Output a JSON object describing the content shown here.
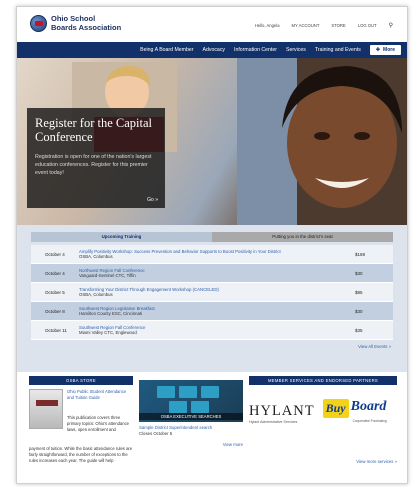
{
  "header": {
    "org_name_line1": "Ohio School",
    "org_name_line2": "Boards Association",
    "greeting": "Hello, Angela",
    "my_account": "MY ACCOUNT",
    "store": "STORE",
    "log_out": "LOG OUT"
  },
  "nav": {
    "items": [
      "Being A Board Member",
      "Advocacy",
      "Information Center",
      "Services",
      "Training and Events"
    ],
    "more_label": "More"
  },
  "hero": {
    "title": "Register for the Capital Conference",
    "text": "Registration is open for one of the nation's largest education conferences. Register for this premier event today!",
    "go_label": "Go »"
  },
  "tabs": {
    "upcoming": "Upcoming Training",
    "district": "Putting you in the district's seat"
  },
  "events": [
    {
      "date": "October 4",
      "title": "Amplify Positivity Workshop: Success Prevention and Behavior Supports to Boost Positivity in Your District",
      "location": "OSBA, Columbus",
      "price": "$169"
    },
    {
      "date": "October 4",
      "title": "Northwest Region Fall Conference",
      "location": "Vanguard-Sentinel CTC, Tiffin",
      "price": "$30"
    },
    {
      "date": "October 5",
      "title": "Transforming Your District Through Engagement Workshop (CANCELED)",
      "location": "OSBA, Columbus",
      "price": "$85"
    },
    {
      "date": "October 8",
      "title": "Southwest Region Legislative Breakfast",
      "location": "Hamilton County ESC, Cincinnati",
      "price": "$30"
    },
    {
      "date": "October 11",
      "title": "Southwest Region Fall Conference",
      "location": "Miami Valley CTC, Englewood",
      "price": "$35"
    }
  ],
  "events_view_all": "View All Events »",
  "store": {
    "heading": "OSBA STORE",
    "title": "Ohio Public Student Attendance and Tuition Guide",
    "text": "This publication covers three primary topics: Ohio's attendance laws, open enrollment and",
    "text2": "payment of tuition. While the basic attendance rules are fairly straightforward, the number of exceptions to the rules increases each year. The guide will help"
  },
  "exec": {
    "heading": "OSBA EXECUTIVE SEARCHES",
    "image_label": "OSBA EXECUTIVE SEARCHES",
    "title": "Sample District Superintendent search",
    "sub": "Closes October 5",
    "view_more": "View more"
  },
  "partners": {
    "heading": "MEMBER SERVICES AND ENDORSED PARTNERS",
    "hylant": "HYLANT",
    "hylant_sub": "Hylant Administrative Services",
    "buy": "Buy",
    "board": "Board",
    "buyboard_sub": "Cooperative Purchasing",
    "view_more": "View more services »"
  }
}
